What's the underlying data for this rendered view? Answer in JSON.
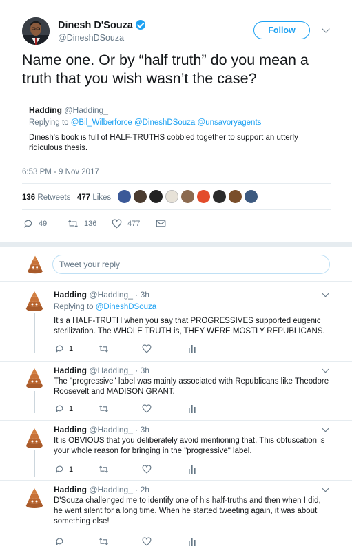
{
  "tweet": {
    "author_name": "Dinesh D'Souza",
    "author_handle": "@DineshDSouza",
    "follow_label": "Follow",
    "text": "Name one. Or by “half truth” do you mean a truth that you wish wasn’t the case?",
    "quoted": {
      "name": "Hadding",
      "handle": "@Hadding_",
      "replying_prefix": "Replying to",
      "replying_to": "@Bil_Wilberforce @DineshDSouza @unsavoryagents",
      "text": "Dinesh's book is full of HALF-TRUTHS cobbled together to support an utterly ridiculous thesis."
    },
    "timestamp": "6:53 PM - 9 Nov 2017",
    "retweets_count": "136",
    "retweets_label": "Retweets",
    "likes_count": "477",
    "likes_label": "Likes",
    "actions": {
      "replies": "49",
      "retweets": "136",
      "likes": "477"
    }
  },
  "reply_box": {
    "placeholder": "Tweet your reply"
  },
  "replies": [
    {
      "name": "Hadding",
      "handle": "@Hadding_",
      "time": "· 3h",
      "replying_prefix": "Replying to",
      "replying_to": "@DineshDSouza",
      "text": "It's a HALF-TRUTH when you say that PROGRESSIVES supported eugenic sterilization. The WHOLE TRUTH is, THEY WERE MOSTLY REPUBLICANS.",
      "reply_count": "1"
    },
    {
      "name": "Hadding",
      "handle": "@Hadding_",
      "time": "· 3h",
      "text": "The \"progressive\" label was mainly associated with Republicans like Theodore Roosevelt and MADISON GRANT.",
      "reply_count": "1"
    },
    {
      "name": "Hadding",
      "handle": "@Hadding_",
      "time": "· 3h",
      "text": "It is OBVIOUS that you deliberately avoid mentioning that. This obfuscation is your whole reason for bringing in the \"progressive\" label.",
      "reply_count": "1"
    },
    {
      "name": "Hadding",
      "handle": "@Hadding_",
      "time": "· 2h",
      "text": "D'Souza challenged me to identify one of his half-truths and then when I did, he went silent for a long time. When he started tweeting again, it was about something else!"
    }
  ],
  "colors": {
    "accent": "#1da1f2",
    "muted": "#657786",
    "divider": "#e6ecf0"
  },
  "icons": [
    "verified-badge-icon",
    "chevron-down-icon",
    "reply-icon",
    "retweet-icon",
    "like-heart-icon",
    "direct-message-icon",
    "analytics-icon"
  ]
}
